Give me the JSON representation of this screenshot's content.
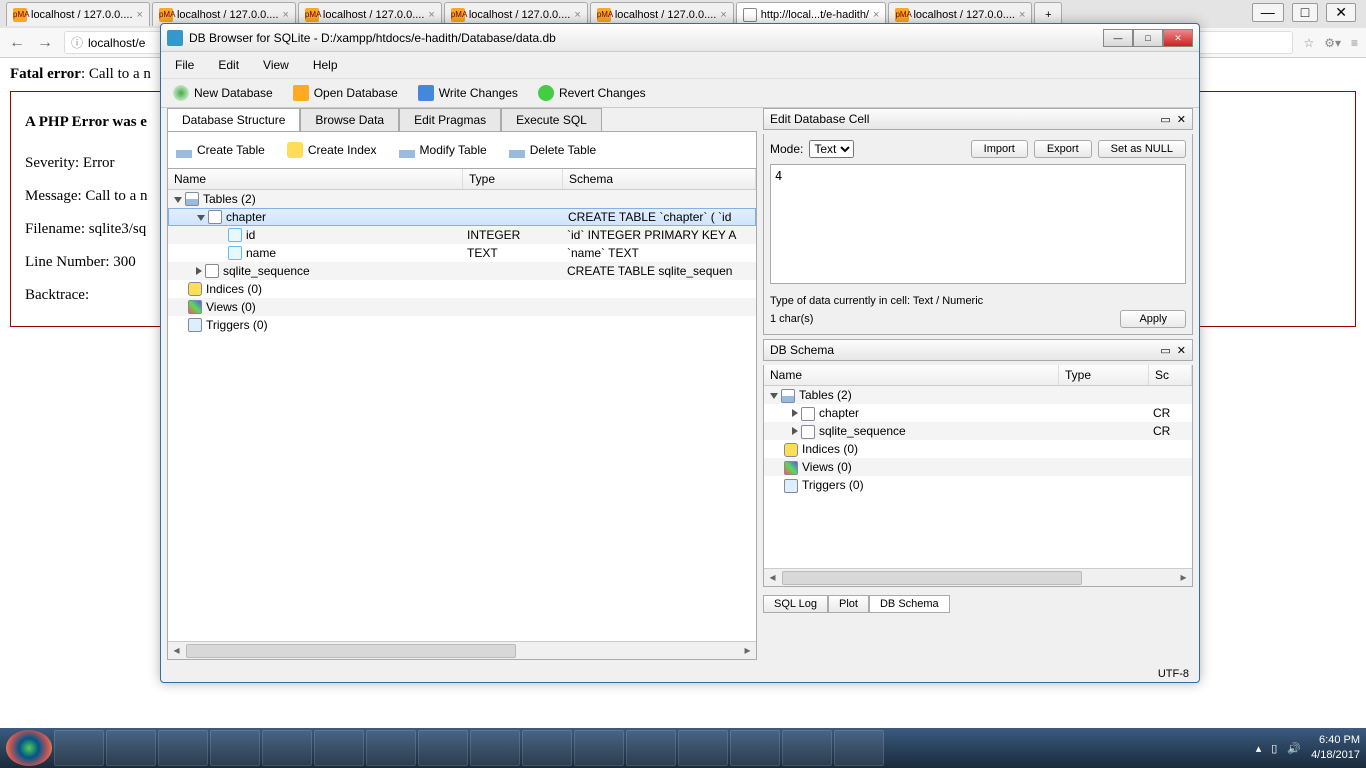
{
  "browser": {
    "tabs": [
      {
        "label": "localhost / 127.0.0....",
        "active": false
      },
      {
        "label": "localhost / 127.0.0....",
        "active": false
      },
      {
        "label": "localhost / 127.0.0....",
        "active": false
      },
      {
        "label": "localhost / 127.0.0....",
        "active": false
      },
      {
        "label": "localhost / 127.0.0....",
        "active": false
      },
      {
        "label": "http://local...t/e-hadith/",
        "active": true
      },
      {
        "label": "localhost / 127.0.0....",
        "active": false
      }
    ],
    "address": "localhost/e"
  },
  "php": {
    "fatal_label": "Fatal error",
    "fatal_msg": ": Call to a n",
    "box_title": "A PHP Error was e",
    "severity_label": "Severity: Error",
    "message_label": "Message: Call to a n",
    "filename_label": "Filename: sqlite3/sq",
    "line_label": "Line Number: 300",
    "backtrace_label": "Backtrace:"
  },
  "db": {
    "title": "DB Browser for SQLite - D:/xampp/htdocs/e-hadith/Database/data.db",
    "menu": {
      "file": "File",
      "edit": "Edit",
      "view": "View",
      "help": "Help"
    },
    "toolbar": {
      "new": "New Database",
      "open": "Open Database",
      "write": "Write Changes",
      "revert": "Revert Changes"
    },
    "tabs": {
      "structure": "Database Structure",
      "browse": "Browse Data",
      "pragmas": "Edit Pragmas",
      "sql": "Execute SQL"
    },
    "tabletoolbar": {
      "create_table": "Create Table",
      "create_index": "Create Index",
      "modify": "Modify Table",
      "delete": "Delete Table"
    },
    "treecols": {
      "name": "Name",
      "type": "Type",
      "schema": "Schema"
    },
    "tree": {
      "tables_label": "Tables (2)",
      "chapter": {
        "label": "chapter",
        "schema": "CREATE TABLE `chapter` ( `id"
      },
      "id": {
        "label": "id",
        "type": "INTEGER",
        "schema": "`id` INTEGER PRIMARY KEY A"
      },
      "name": {
        "label": "name",
        "type": "TEXT",
        "schema": "`name` TEXT"
      },
      "sqlite_sequence": {
        "label": "sqlite_sequence",
        "schema": "CREATE TABLE sqlite_sequen"
      },
      "indices": "Indices (0)",
      "views": "Views (0)",
      "triggers": "Triggers (0)"
    },
    "editcell": {
      "title": "Edit Database Cell",
      "mode_label": "Mode:",
      "mode_value": "Text",
      "import": "Import",
      "export": "Export",
      "setnull": "Set as NULL",
      "value": "4",
      "datatype": "Type of data currently in cell: Text / Numeric",
      "chars": "1 char(s)",
      "apply": "Apply"
    },
    "schema": {
      "title": "DB Schema",
      "tables_label": "Tables (2)",
      "chapter": {
        "label": "chapter",
        "schema": "CR"
      },
      "sqlite_sequence": {
        "label": "sqlite_sequence",
        "schema": "CR"
      },
      "indices": "Indices (0)",
      "views": "Views (0)",
      "triggers": "Triggers (0)"
    },
    "bottomtabs": {
      "sqllog": "SQL Log",
      "plot": "Plot",
      "dbschema": "DB Schema"
    },
    "status": "UTF-8"
  },
  "taskbar": {
    "time": "6:40 PM",
    "date": "4/18/2017"
  }
}
